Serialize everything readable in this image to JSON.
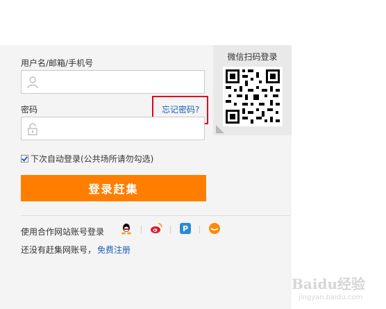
{
  "login": {
    "username_label": "用户名/邮箱/手机号",
    "username_value": "",
    "password_label": "密码",
    "password_value": "",
    "forgot_link": "忘记密码?",
    "remember_label": "下次自动登录(公共场所请勿勾选)",
    "remember_checked": true,
    "login_button": "登录赶集"
  },
  "qr": {
    "title": "微信扫码登录"
  },
  "partners": {
    "label": "使用合作网站账号登录",
    "icons": [
      "qq-icon",
      "weibo-icon",
      "p-icon",
      "orange-icon"
    ]
  },
  "register": {
    "prefix": "还没有赶集网账号，",
    "link": "免费注册"
  },
  "watermark": {
    "text": "Baidu经验",
    "sub": "jingyan.baidu.com"
  },
  "colors": {
    "accent": "#ff7e00",
    "link": "#1a5fb4",
    "highlight_box": "#e0001b"
  }
}
